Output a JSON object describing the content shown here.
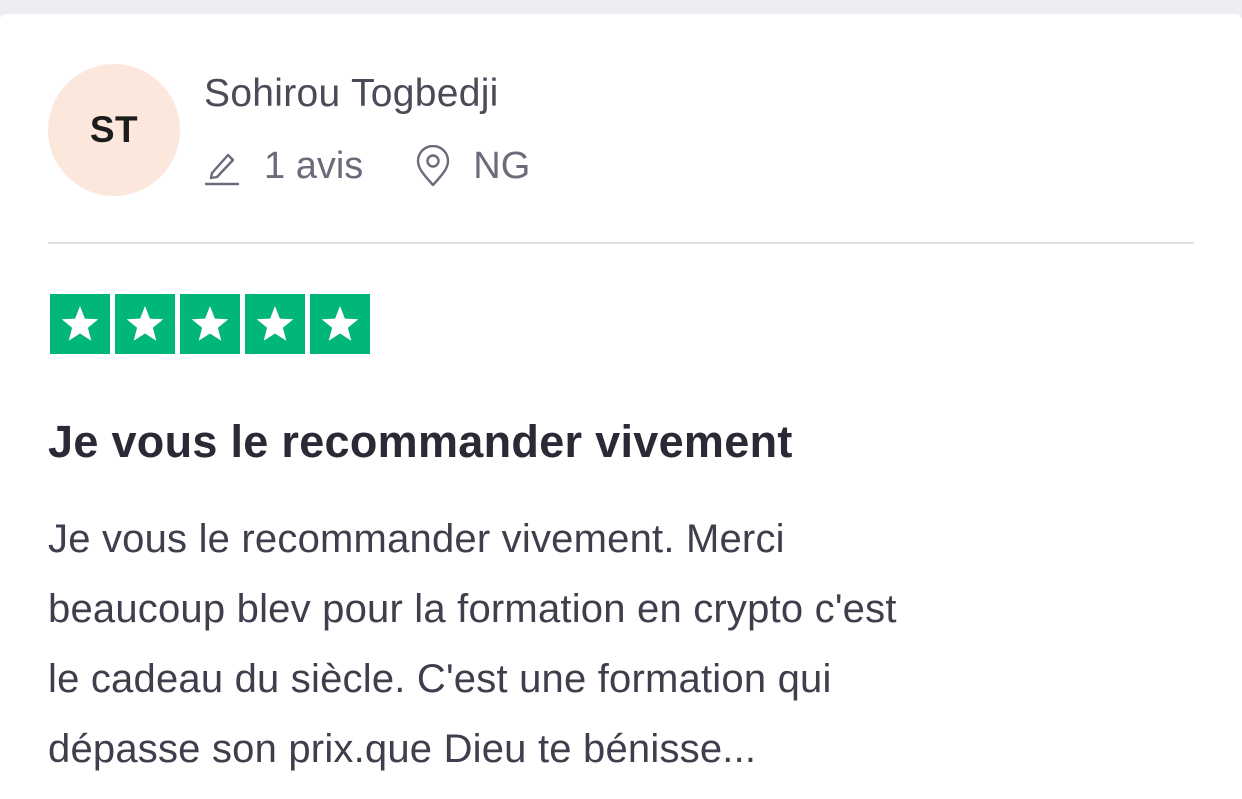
{
  "reviewer": {
    "initials": "ST",
    "name": "Sohirou Togbedji",
    "review_count": "1 avis",
    "country": "NG"
  },
  "icons": {
    "review_count": "pencil-icon",
    "country": "location-pin-icon",
    "star": "star-icon"
  },
  "rating": {
    "stars": 5,
    "max": 5,
    "color": "#00b67a"
  },
  "review": {
    "title": "Je vous le recommander vivement",
    "body_lines": [
      "Je vous le recommander vivement. Merci",
      "beaucoup blev pour la formation en crypto c'est",
      "le cadeau du siècle. C'est une formation qui",
      "dépasse son prix.que Dieu te bénisse..."
    ]
  },
  "colors": {
    "avatar_bg": "#fce7dd",
    "page_bg": "#eeeef2",
    "divider": "#dedee4"
  }
}
